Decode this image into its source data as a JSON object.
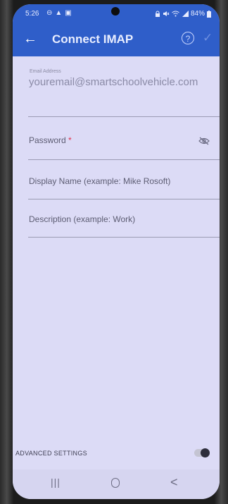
{
  "status_bar": {
    "time": "5:26",
    "left_icons": [
      "circle-minus-icon",
      "warning-icon",
      "gallery-icon"
    ],
    "right_icons": [
      "lock-icon",
      "mute-icon",
      "wifi-icon",
      "signal-icon"
    ],
    "battery": "84%"
  },
  "app_bar": {
    "title": "Connect IMAP",
    "back_icon": "←",
    "help_icon": "?",
    "confirm_icon": "✓",
    "color": "#2f5ec9"
  },
  "form": {
    "email": {
      "label": "Email Address",
      "value": "youremail@smartschoolvehicle.com"
    },
    "password": {
      "placeholder": "Password",
      "required_marker": "*"
    },
    "display_name": {
      "placeholder": "Display Name (example: Mike Rosoft)"
    },
    "description": {
      "placeholder": "Description (example: Work)"
    }
  },
  "advanced": {
    "label": "ADVANCED SETTINGS",
    "enabled": false
  },
  "nav_bar": {
    "recents": "|||",
    "back": "<"
  }
}
